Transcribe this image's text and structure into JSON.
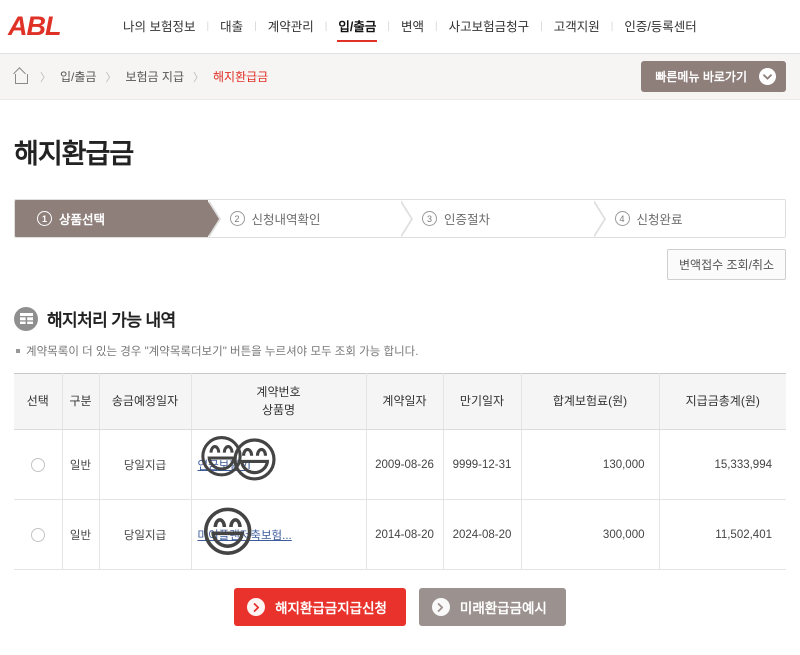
{
  "brand": {
    "logo_text": "ABL",
    "logo_color": "#e03127"
  },
  "global_nav": {
    "items": [
      {
        "label": "나의 보험정보",
        "active": false
      },
      {
        "label": "대출",
        "active": false
      },
      {
        "label": "계약관리",
        "active": false
      },
      {
        "label": "입/출금",
        "active": true
      },
      {
        "label": "변액",
        "active": false
      },
      {
        "label": "사고보험금청구",
        "active": false
      },
      {
        "label": "고객지원",
        "active": false
      },
      {
        "label": "인증/등록센터",
        "active": false
      }
    ],
    "separator": "|"
  },
  "breadcrumb": {
    "home_icon": "home-icon",
    "separator": "〉",
    "items": [
      {
        "label": "입/출금",
        "current": false
      },
      {
        "label": "보험금 지급",
        "current": false
      },
      {
        "label": "해지환급금",
        "current": true
      }
    ]
  },
  "quick_menu": {
    "label": "빠른메뉴 바로가기",
    "icon": "chevron-down-icon",
    "bg_color": "#8e7f7b"
  },
  "page": {
    "title": "해지환급금"
  },
  "steps": {
    "items": [
      {
        "num": "1",
        "label": "상품선택",
        "active": true
      },
      {
        "num": "2",
        "label": "신청내역확인",
        "active": false
      },
      {
        "num": "3",
        "label": "인증절차",
        "active": false
      },
      {
        "num": "4",
        "label": "신청완료",
        "active": false
      }
    ],
    "active_color": "#8e7f7b"
  },
  "sub_action": {
    "inquiry_cancel_label": "변액접수 조회/취소"
  },
  "section": {
    "icon": "table-list-icon",
    "title": "해지처리 가능 내역",
    "notice": "계약목록이 더 있는 경우 \"계약목록더보기\" 버튼을 누르셔야 모두 조회 가능 합니다."
  },
  "table": {
    "headers": [
      "선택",
      "구분",
      "송금예정일자",
      "계약번호\n상품명",
      "계약일자",
      "만기일자",
      "합계보험료(원)",
      "지급금총계(원)"
    ],
    "header_contract": {
      "line1": "계약번호",
      "line2": "상품명"
    },
    "rows": [
      {
        "select": "radio-unchecked",
        "type": "일반",
        "remit_date": "당일지급",
        "product_link": "연금보험VI",
        "contract_date": "2009-08-26",
        "maturity_date": "9999-12-31",
        "total_premium": "130,000",
        "payout_total": "15,333,994",
        "emoji_overlays": [
          "😄",
          "😄"
        ]
      },
      {
        "select": "radio-unchecked",
        "type": "일반",
        "remit_date": "당일지급",
        "product_link": "마이플랜저축보험...",
        "contract_date": "2014-08-20",
        "maturity_date": "2024-08-20",
        "total_premium": "300,000",
        "payout_total": "11,502,401",
        "emoji_overlays": [
          "😄"
        ]
      }
    ]
  },
  "actions": {
    "primary": {
      "label": "해지환급금지급신청",
      "icon": "arrow-right-circle-icon",
      "color": "#e8322b"
    },
    "secondary": {
      "label": "미래환급금예시",
      "icon": "arrow-right-circle-icon",
      "color": "#9b918e"
    }
  }
}
